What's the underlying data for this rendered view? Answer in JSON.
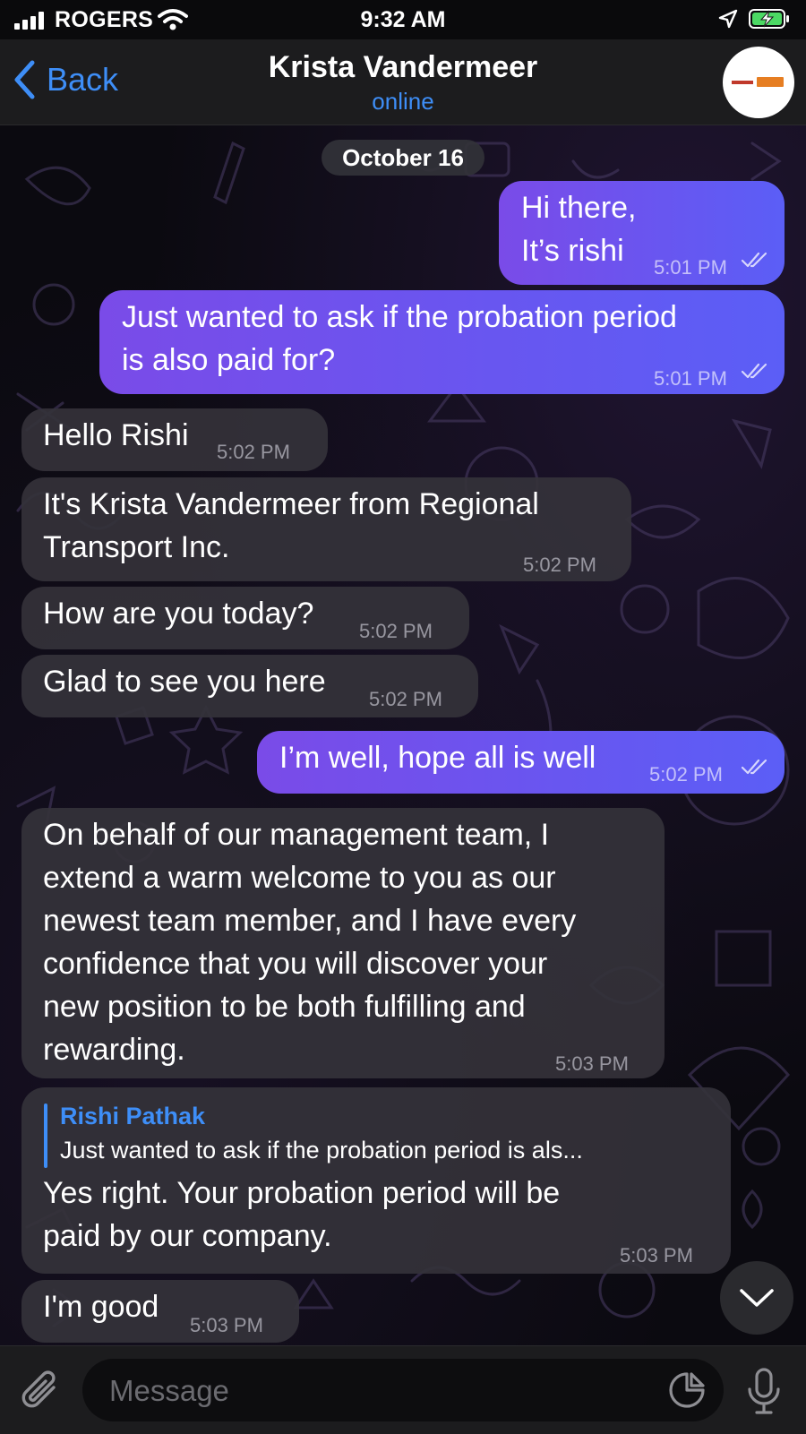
{
  "status_bar": {
    "carrier": "ROGERS",
    "time": "9:32 AM"
  },
  "header": {
    "back_label": "Back",
    "contact_name": "Krista Vandermeer",
    "presence": "online"
  },
  "chat": {
    "date_label": "October 16",
    "messages": [
      {
        "direction": "out",
        "text": "Hi there,\nIt’s rishi",
        "time": "5:01 PM",
        "read": true
      },
      {
        "direction": "out",
        "text": "Just wanted to ask if the probation period\nis also paid for?",
        "time": "5:01 PM",
        "read": true
      },
      {
        "direction": "in",
        "text": "Hello Rishi",
        "time": "5:02 PM"
      },
      {
        "direction": "in",
        "text": "It's Krista Vandermeer from Regional\nTransport Inc.",
        "time": "5:02 PM"
      },
      {
        "direction": "in",
        "text": "How are you today?",
        "time": "5:02 PM"
      },
      {
        "direction": "in",
        "text": "Glad to see you here",
        "time": "5:02 PM"
      },
      {
        "direction": "out",
        "text": "I’m well, hope all is well",
        "time": "5:02 PM",
        "read": true
      },
      {
        "direction": "in",
        "text": "On behalf of our management team, I\nextend a warm welcome to you as our\nnewest team member, and I have every\nconfidence that you will discover your\nnew position to be both fulfilling and\nrewarding.",
        "time": "5:03 PM"
      },
      {
        "direction": "in",
        "text": "Yes right. Your probation period will be\npaid by our company.",
        "time": "5:03 PM",
        "reply_to": {
          "name": "Rishi Pathak",
          "text": "Just wanted to ask if the probation period is als..."
        }
      },
      {
        "direction": "in",
        "text": "I'm good",
        "time": "5:03 PM"
      }
    ]
  },
  "composer": {
    "placeholder": "Message"
  },
  "icons": {
    "back": "chevron-left-icon",
    "avatar": "contact-avatar",
    "attach": "paperclip-icon",
    "sticker": "sticker-icon",
    "mic": "microphone-icon",
    "scroll": "chevron-down-icon",
    "read_receipt": "double-check-icon"
  },
  "colors": {
    "accent": "#3e8ef7",
    "outgoing_bubble_start": "#7a4be8",
    "outgoing_bubble_end": "#5b5ef6",
    "incoming_bubble": "#343238",
    "battery_charging": "#4cd964"
  }
}
